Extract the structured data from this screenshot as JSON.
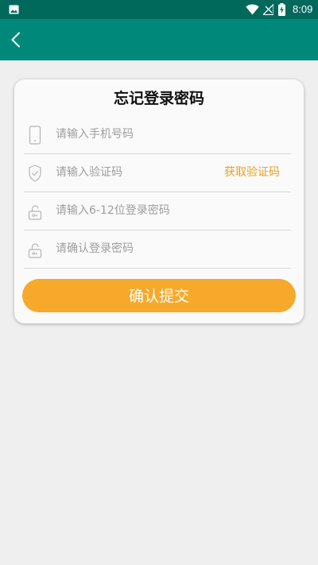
{
  "status_bar": {
    "time": "8:09",
    "icons": [
      "gallery-icon",
      "wifi-icon",
      "signal-icon",
      "battery-icon"
    ]
  },
  "app_bar": {
    "back_icon": "chevron-left-icon"
  },
  "form": {
    "title": "忘记登录密码",
    "fields": [
      {
        "icon": "phone-icon",
        "placeholder": "请输入手机号码",
        "value": ""
      },
      {
        "icon": "shield-check-icon",
        "placeholder": "请输入验证码",
        "value": ""
      },
      {
        "icon": "lock-icon",
        "placeholder": "请输入6-12位登录密码",
        "value": ""
      },
      {
        "icon": "lock-icon",
        "placeholder": "请确认登录密码",
        "value": ""
      }
    ],
    "get_code_label": "获取验证码",
    "submit_label": "确认提交"
  },
  "colors": {
    "status_bar": "#00695c",
    "app_bar": "#00897b",
    "accent": "#f7a92c",
    "link": "#e7a22a",
    "background": "#efefef"
  }
}
